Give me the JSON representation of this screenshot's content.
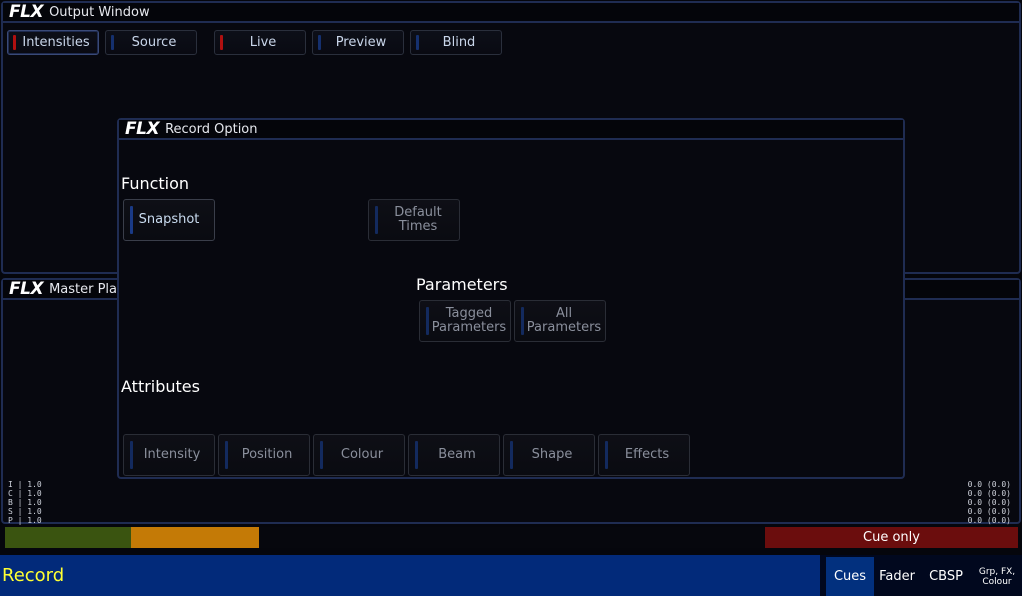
{
  "output_window": {
    "title": "Output Window",
    "tabs": [
      {
        "label": "Intensities",
        "selected": true,
        "indicator": "red"
      },
      {
        "label": "Source",
        "selected": false,
        "indicator": "blue"
      },
      {
        "label": "Live",
        "selected": false,
        "indicator": "red"
      },
      {
        "label": "Preview",
        "selected": false,
        "indicator": "blue"
      },
      {
        "label": "Blind",
        "selected": false,
        "indicator": "blue"
      }
    ]
  },
  "logo_text": "FLX",
  "master_window": {
    "title": "Master Pla",
    "readout_left": [
      "I | 1.0",
      "C | 1.0",
      "B | 1.0",
      "S | 1.0",
      "P | 1.0"
    ],
    "readout_right": [
      "0.0 (0.0)",
      "0.0 (0.0)",
      "0.0 (0.0)",
      "0.0 (0.0)",
      "0.0 (0.0)"
    ]
  },
  "progress_bar": {
    "colors": [
      "#3a5410",
      "#c47a06",
      "#06070d",
      "#6b0d0d"
    ],
    "label": "Cue only"
  },
  "record_dialog": {
    "title": "Record Option",
    "function_heading": "Function",
    "snapshot_label": "Snapshot",
    "default_times_label": "Default Times",
    "parameters_heading": "Parameters",
    "tagged_parameters_label": "Tagged Parameters",
    "all_parameters_label": "All Parameters",
    "attributes_heading": "Attributes",
    "attributes": [
      "Intensity",
      "Position",
      "Colour",
      "Beam",
      "Shape",
      "Effects"
    ]
  },
  "command_line": {
    "text": "Record",
    "color": "#ffff33"
  },
  "bottom_tabs": [
    {
      "label": "Cues",
      "selected": true
    },
    {
      "label": "Fader",
      "selected": false
    },
    {
      "label": "CBSP",
      "selected": false
    },
    {
      "label": "Grp, FX, Colour",
      "selected": false
    }
  ]
}
